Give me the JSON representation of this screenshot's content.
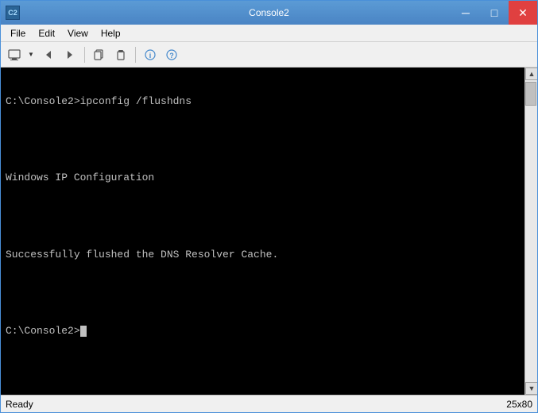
{
  "window": {
    "title": "Console2",
    "icon_label": "C2"
  },
  "title_buttons": {
    "minimize": "─",
    "maximize": "□",
    "close": "✕"
  },
  "menu": {
    "items": [
      "File",
      "Edit",
      "View",
      "Help"
    ]
  },
  "toolbar": {
    "buttons": [
      "⊞",
      "←",
      "→",
      "⧉",
      "⧉",
      "ℹ",
      "?"
    ]
  },
  "terminal": {
    "lines": [
      "C:\\Console2>ipconfig /flushdns",
      "",
      "Windows IP Configuration",
      "",
      "Successfully flushed the DNS Resolver Cache.",
      "",
      "C:\\Console2>"
    ],
    "prompt": "C:\\Console2>"
  },
  "status": {
    "left": "Ready",
    "right": "25x80"
  }
}
